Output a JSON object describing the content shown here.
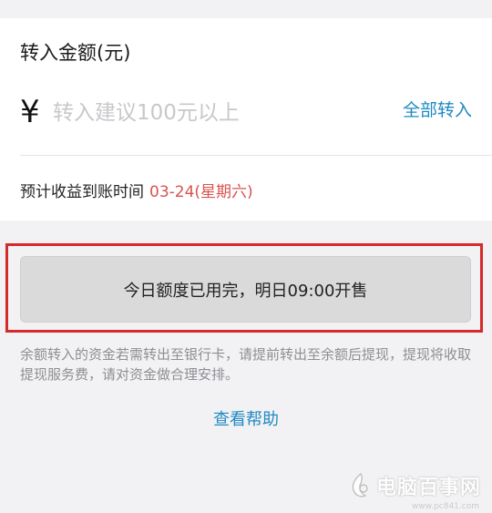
{
  "transfer": {
    "title": "转入金额(元)",
    "currency_symbol": "¥",
    "amount_value": "",
    "amount_placeholder": "转入建议100元以上",
    "all_in_label": "全部转入",
    "arrival_label": "预计收益到账时间",
    "arrival_date": "03-24(星期六)"
  },
  "action": {
    "button_label": "今日额度已用完，明日09:00开售"
  },
  "notice": {
    "text": "余额转入的资金若需转出至银行卡，请提前转出至余额后提现，提现将收取提现服务费，请对资金做合理安排。"
  },
  "help": {
    "label": "查看帮助"
  },
  "watermark": {
    "text": "电脑百事网",
    "sub": "www.pc841.com"
  },
  "colors": {
    "accent": "#1f8ac2",
    "date_red": "#d9534f",
    "highlight_border": "#d52a2a",
    "disabled_button": "#dadada",
    "background": "#f2f2f4"
  }
}
